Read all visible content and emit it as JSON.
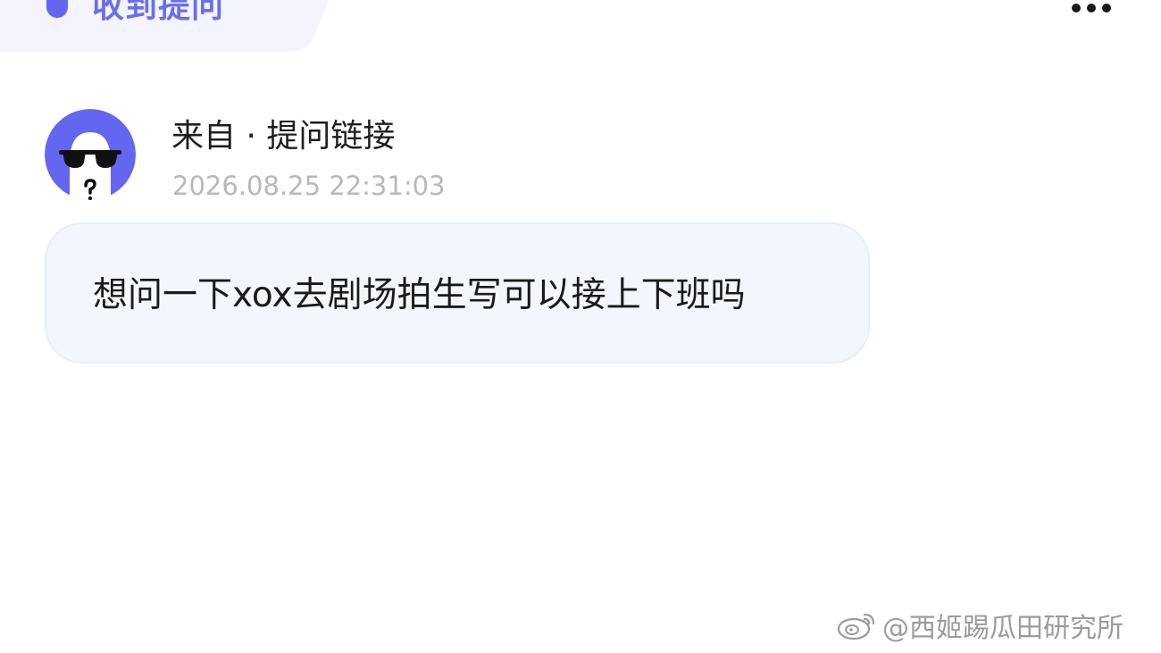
{
  "header": {
    "title": "收到提问",
    "accent_color": "#6466f1",
    "more_icon": "more-horizontal-icon"
  },
  "sender": {
    "name": "来自 · 提问链接",
    "timestamp": "2026.08.25 22:31:03",
    "avatar_icon": "anonymous-sunglasses-avatar-icon",
    "avatar_bg": "#6466f1"
  },
  "message": {
    "text": "想问一下xox去剧场拍生写可以接上下班吗"
  },
  "watermark": {
    "text": "@西姬踢瓜田研究所",
    "logo_icon": "weibo-logo-icon"
  }
}
